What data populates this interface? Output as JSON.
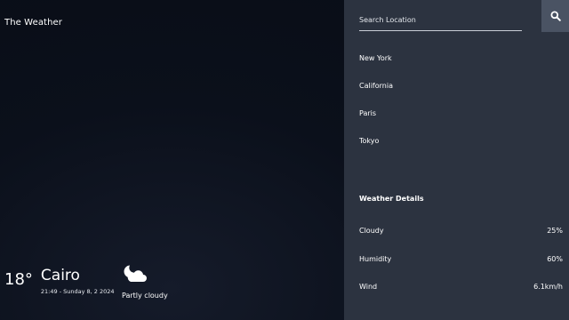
{
  "app": {
    "brand": "The Weather"
  },
  "current": {
    "temperature": "18°",
    "city": "Cairo",
    "datetime": "21:49 - Sunday 8, 2 2024",
    "condition": "Partly cloudy",
    "condition_icon": "partly-cloudy-night-icon"
  },
  "search": {
    "placeholder": "Search Location",
    "button_icon": "search-icon"
  },
  "locations": [
    "New York",
    "California",
    "Paris",
    "Tokyo"
  ],
  "details": {
    "title": "Weather Details",
    "rows": [
      {
        "label": "Cloudy",
        "value": "25%"
      },
      {
        "label": "Humidity",
        "value": "60%"
      },
      {
        "label": "Wind",
        "value": "6.1km/h"
      }
    ]
  },
  "colors": {
    "background": "#0a0f1a",
    "panel": "#2c3340",
    "search_button": "#4a5363",
    "text": "#ffffff"
  }
}
